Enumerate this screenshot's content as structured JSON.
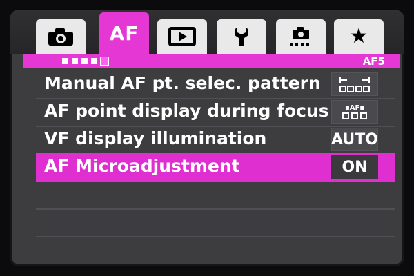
{
  "tabs": [
    {
      "icon": "camera-icon",
      "label": ""
    },
    {
      "icon": "",
      "label": "AF"
    },
    {
      "icon": "playback-icon",
      "label": ""
    },
    {
      "icon": "wrench-icon",
      "label": ""
    },
    {
      "icon": "custom-function-icon",
      "label": ""
    },
    {
      "icon": "star-icon",
      "label": ""
    }
  ],
  "active_tab_index": 1,
  "submenu": {
    "page_label": "AF5",
    "page_count": 5,
    "current_page": 5
  },
  "menu_items": [
    {
      "label": "Manual AF pt. selec. pattern",
      "value": "",
      "value_icon": "af-point-pattern-icon",
      "selected": false
    },
    {
      "label": "AF point display during focus",
      "value": "",
      "value_icon": "af-point-display-icon",
      "selected": false
    },
    {
      "label": "VF display illumination",
      "value": "AUTO",
      "value_icon": "",
      "selected": false
    },
    {
      "label": "AF Microadjustment",
      "value": "ON",
      "value_icon": "",
      "selected": true
    }
  ],
  "colors": {
    "accent": "#e437d3",
    "background": "#3d3d40",
    "text": "#ffffff"
  }
}
